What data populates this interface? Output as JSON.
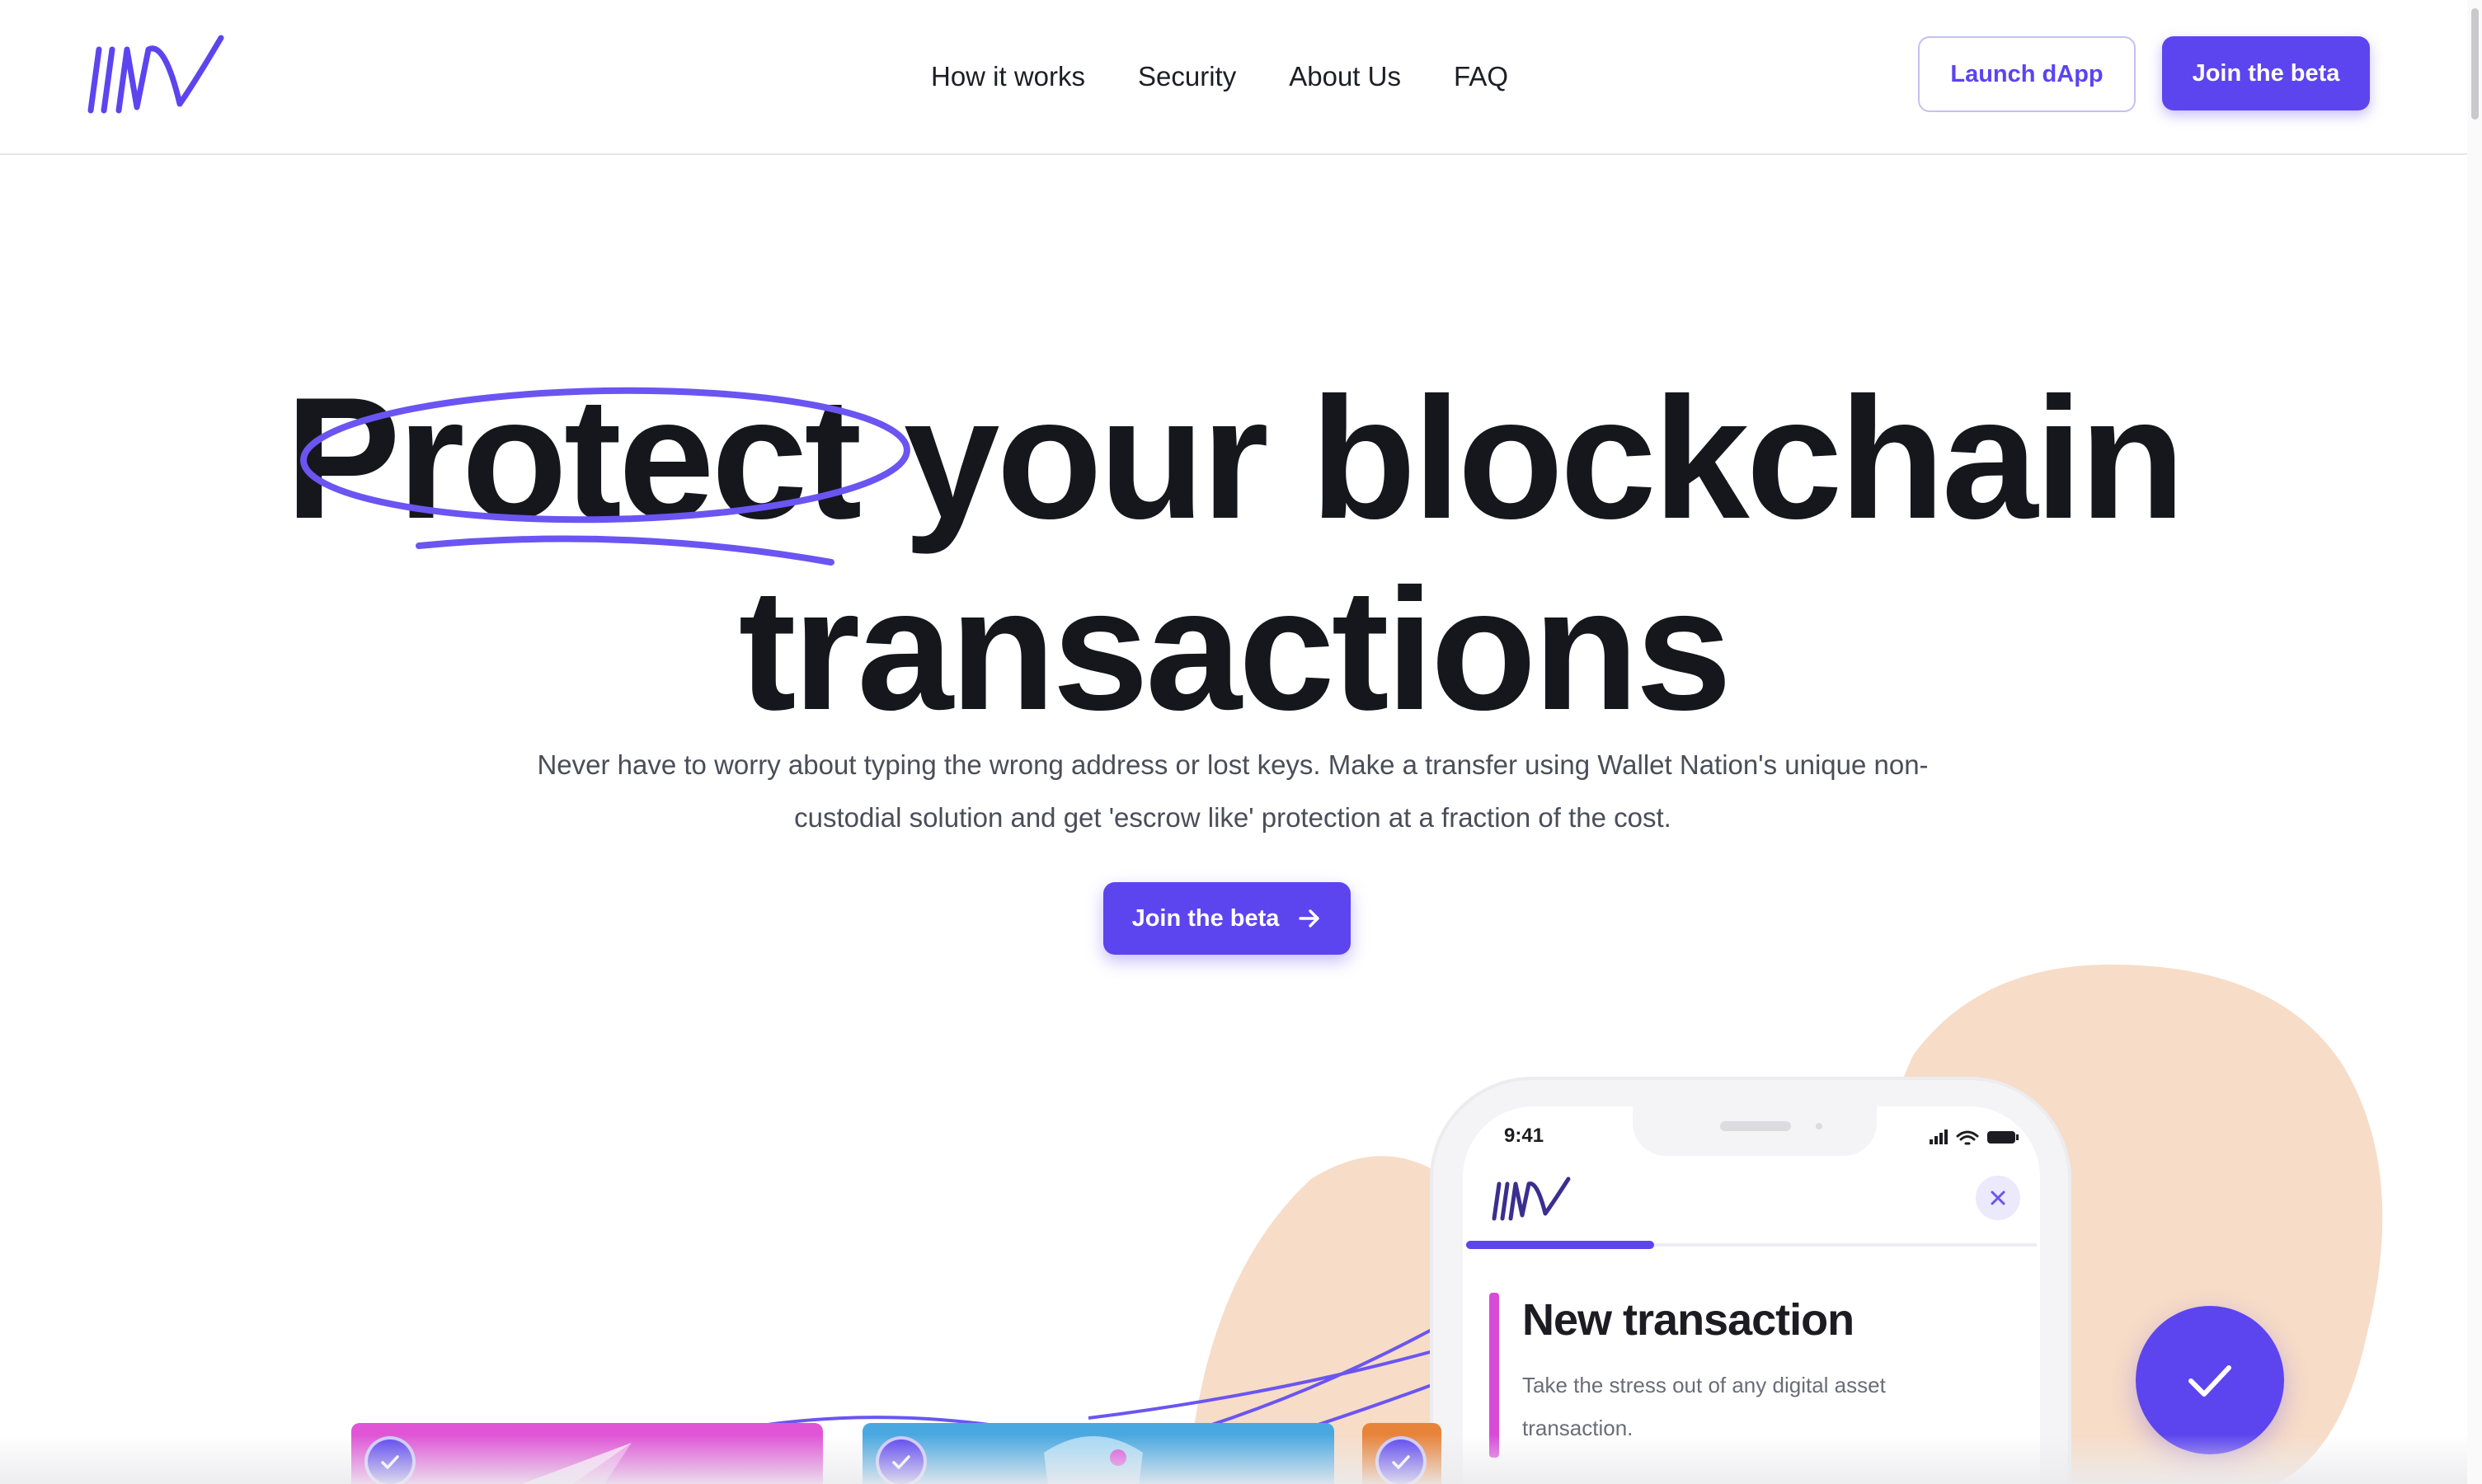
{
  "brand": {
    "logo_icon": "wallet-nation-logo-icon",
    "accent_color": "#5c45ef"
  },
  "nav": {
    "items": [
      {
        "label": "How it works"
      },
      {
        "label": "Security"
      },
      {
        "label": "About Us"
      },
      {
        "label": "FAQ"
      }
    ],
    "launch_label": "Launch dApp",
    "join_label": "Join the beta"
  },
  "hero": {
    "title_line1": "Protect your blockchain",
    "title_line2": "transactions",
    "subtitle_line1": "Never have to worry about typing the wrong address or lost keys. Make a transfer using Wallet Nation's unique non-",
    "subtitle_line2": "custodial solution and get 'escrow like' protection at a fraction of the cost.",
    "cta_label": "Join the beta",
    "cta_icon": "arrow-right-icon"
  },
  "phone": {
    "time": "9:41",
    "progress": 0.33,
    "card_title": "New transaction",
    "card_desc": "Take the stress out of any digital asset transaction.",
    "close_icon": "close-icon",
    "confirm_icon": "check-icon"
  },
  "colors": {
    "peach": "#f7dcc7",
    "pink_tile": "#e055d6",
    "blue_tile": "#4aa8e0",
    "orange_tile": "#e8843a"
  }
}
